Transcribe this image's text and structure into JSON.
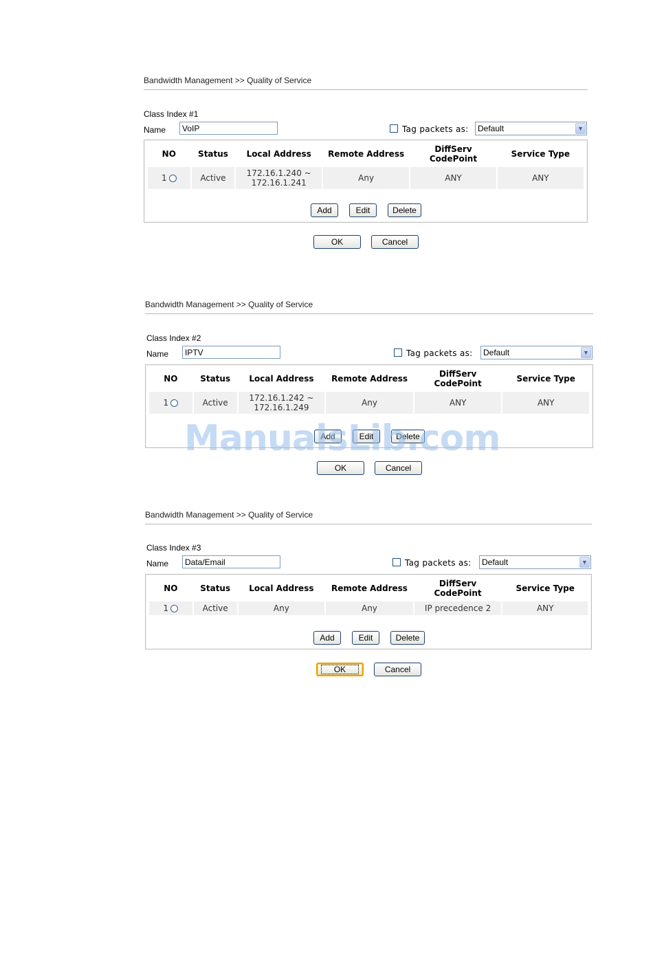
{
  "panels": [
    {
      "breadcrumb": "Bandwidth Management >> Quality of Service",
      "class_index": "Class Index #1",
      "name_label": "Name",
      "name_value": "VoIP",
      "tag_label": "Tag packets as:",
      "tag_checked": false,
      "tag_value": "Default",
      "headers": {
        "no": "NO",
        "status": "Status",
        "local": "Local Address",
        "remote": "Remote Address",
        "diff1": "DiffServ",
        "diff2": "CodePoint",
        "service": "Service Type"
      },
      "row": {
        "no": "1",
        "status": "Active",
        "local1": "172.16.1.240 ~",
        "local2": "172.16.1.241",
        "remote": "Any",
        "codepoint": "ANY",
        "service": "ANY"
      },
      "buttons": {
        "add": "Add",
        "edit": "Edit",
        "delete": "Delete",
        "ok": "OK",
        "cancel": "Cancel"
      }
    },
    {
      "breadcrumb": "Bandwidth Management >> Quality of Service",
      "class_index": "Class Index #2",
      "name_label": "Name",
      "name_value": "IPTV",
      "tag_label": "Tag packets as:",
      "tag_checked": false,
      "tag_value": "Default",
      "headers": {
        "no": "NO",
        "status": "Status",
        "local": "Local Address",
        "remote": "Remote Address",
        "diff1": "DiffServ",
        "diff2": "CodePoint",
        "service": "Service Type"
      },
      "row": {
        "no": "1",
        "status": "Active",
        "local1": "172.16.1.242 ~",
        "local2": "172.16.1.249",
        "remote": "Any",
        "codepoint": "ANY",
        "service": "ANY"
      },
      "buttons": {
        "add": "Add",
        "edit": "Edit",
        "delete": "Delete",
        "ok": "OK",
        "cancel": "Cancel"
      }
    },
    {
      "breadcrumb": "Bandwidth Management >> Quality of Service",
      "class_index": "Class Index #3",
      "name_label": "Name",
      "name_value": "Data/Email",
      "tag_label": "Tag packets as:",
      "tag_checked": false,
      "tag_value": "Default",
      "headers": {
        "no": "NO",
        "status": "Status",
        "local": "Local Address",
        "remote": "Remote Address",
        "diff1": "DiffServ",
        "diff2": "CodePoint",
        "service": "Service Type"
      },
      "row": {
        "no": "1",
        "status": "Active",
        "local1": "Any",
        "local2": "",
        "remote": "Any",
        "codepoint": "IP precedence 2",
        "service": "ANY"
      },
      "buttons": {
        "add": "Add",
        "edit": "Edit",
        "delete": "Delete",
        "ok": "OK",
        "cancel": "Cancel"
      }
    }
  ],
  "watermark": "ManualsLib.com",
  "icons": {
    "radio": "radio-button-icon",
    "dropdown": "chevron-down-icon",
    "checkbox": "checkbox-icon"
  },
  "colors": {
    "cell_background": "#f0f0f0",
    "border": "#c0c0c0",
    "focus_ring": "#e8a200"
  }
}
